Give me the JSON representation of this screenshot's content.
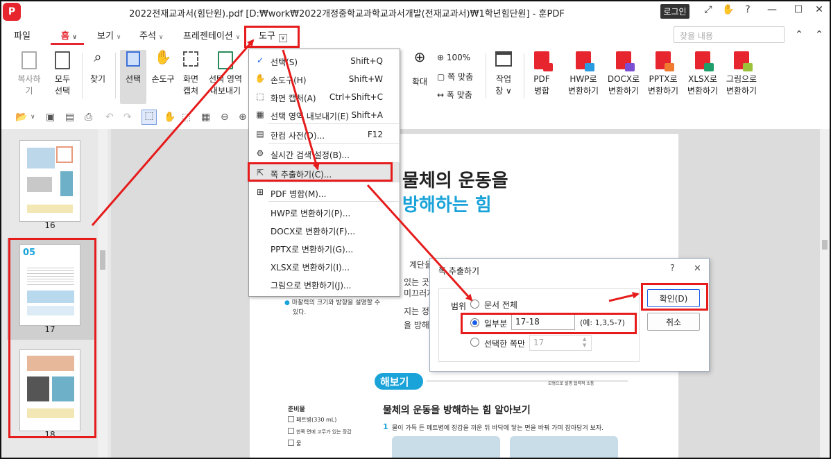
{
  "window": {
    "title": "2022전재교과서(힘단원).pdf [D:₩work₩2022개정중학교과학교과서개발(전재교과서)₩1학년힘단원] - 훈PDF",
    "login_label": "로그인"
  },
  "menu": {
    "file": "파일",
    "tabs": [
      "홈",
      "보기",
      "주석",
      "프레젠테이션",
      "도구"
    ],
    "search_placeholder": "찾을 내용"
  },
  "ribbon": {
    "copy": "복사하기",
    "select_all": [
      "모두",
      "선택"
    ],
    "find": "찾기",
    "select": "선택",
    "hand": "손도구",
    "capture": [
      "화면",
      "캡처"
    ],
    "export_sel": [
      "선택 영역",
      "내보내기"
    ],
    "zoom_pct": "100%",
    "fit_page": "쪽 맞춤",
    "fit_width": "폭 맞춤",
    "enlarge": "확대",
    "work_window": [
      "작업",
      "창"
    ],
    "pdf_merge": [
      "PDF",
      "병합"
    ],
    "hwp": [
      "HWP로",
      "변환하기"
    ],
    "docx": [
      "DOCX로",
      "변환하기"
    ],
    "pptx": [
      "PPTX로",
      "변환하기"
    ],
    "xlsx": [
      "XLSX로",
      "변환하기"
    ],
    "image": [
      "그림으로",
      "변환하기"
    ]
  },
  "dropdown": {
    "items": [
      {
        "label": "선택(S)",
        "shortcut": "Shift+Q",
        "icon": "check-icon"
      },
      {
        "label": "손도구(H)",
        "shortcut": "Shift+W",
        "icon": "hand-icon"
      },
      {
        "label": "화면 캡처(A)",
        "shortcut": "Ctrl+Shift+C",
        "icon": "capture-icon"
      },
      {
        "label": "선택 영역 내보내기(E)",
        "shortcut": "Shift+A",
        "icon": "export-icon"
      },
      {
        "label": "한컴 사전(D)...",
        "shortcut": "F12",
        "icon": "dictionary-icon"
      },
      {
        "label": "실시간 검색 설정(B)...",
        "shortcut": "",
        "icon": "gear-icon"
      },
      {
        "label": "쪽 추출하기(C)...",
        "shortcut": "",
        "icon": "extract-icon"
      },
      {
        "label": "PDF 병합(M)...",
        "shortcut": "",
        "icon": "merge-icon"
      },
      {
        "label": "HWP로 변환하기(P)...",
        "shortcut": "",
        "icon": ""
      },
      {
        "label": "DOCX로 변환하기(F)...",
        "shortcut": "",
        "icon": ""
      },
      {
        "label": "PPTX로 변환하기(G)...",
        "shortcut": "",
        "icon": ""
      },
      {
        "label": "XLSX로 변환하기(I)...",
        "shortcut": "",
        "icon": ""
      },
      {
        "label": "그림으로 변환하기(J)...",
        "shortcut": "",
        "icon": ""
      }
    ]
  },
  "thumbnails": [
    "16",
    "17",
    "18"
  ],
  "page": {
    "heading1": "물체의 운동을",
    "heading2": "방해하는 힘",
    "body_lines": [
      "계단을",
      "있는 곳",
      "미끄러지",
      "지는 정",
      "을 방해"
    ],
    "bullet": "마찰력의 크기와 방향을 설명할 수",
    "bullet2": "있다.",
    "badge": "해보기",
    "badge_tags": "모형으로 설명  협력적 소통",
    "section_title": "물체의 운동을 방해하는 힘 알아보기",
    "step_num": "1",
    "step_text": "물이 가득 든 페트병에 장갑을 끼운 뒤 바닥에 닿는 면을 바꿔 가며 잡아당겨 보자.",
    "prep_title": "준비물",
    "prep_items": [
      "페트병(330 mL)",
      "한쪽 면에 고무가 있는 장갑",
      "물"
    ]
  },
  "dialog": {
    "title": "쪽 추출하기",
    "range_label": "범위",
    "opt_all": "문서 전체",
    "opt_part": "일부분",
    "part_value": "17-18",
    "part_hint": "(예: 1,3,5-7)",
    "opt_selected": "선택한 쪽만",
    "selected_value": "17",
    "ok": "확인(D)",
    "cancel": "취소"
  },
  "colors": {
    "accent": "#e6252e",
    "annotation": "#e61b1b",
    "radio": "#1a5ee8",
    "heading_blue": "#1aa3d9"
  }
}
